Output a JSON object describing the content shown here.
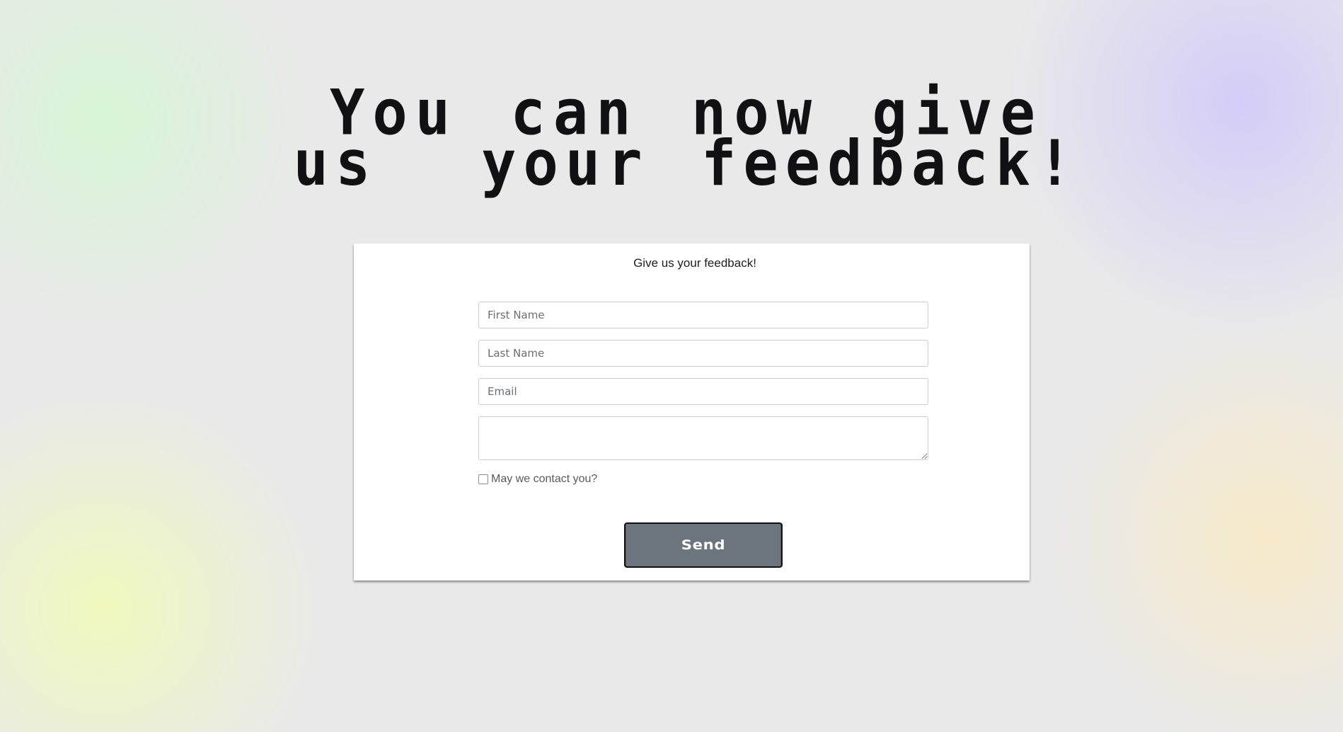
{
  "headline": {
    "line1": "You can now give",
    "line2": "us  your feedback!"
  },
  "form": {
    "title": "Give us your feedback!",
    "first_name_placeholder": "First Name",
    "last_name_placeholder": "Last Name",
    "email_placeholder": "Email",
    "message_value": "",
    "contact_label": "May we contact you?",
    "contact_checked": false,
    "send_label": "Send"
  },
  "colors": {
    "background": "#e9e9e9",
    "card": "#ffffff",
    "button": "#6c757d",
    "headline": "#111114"
  }
}
